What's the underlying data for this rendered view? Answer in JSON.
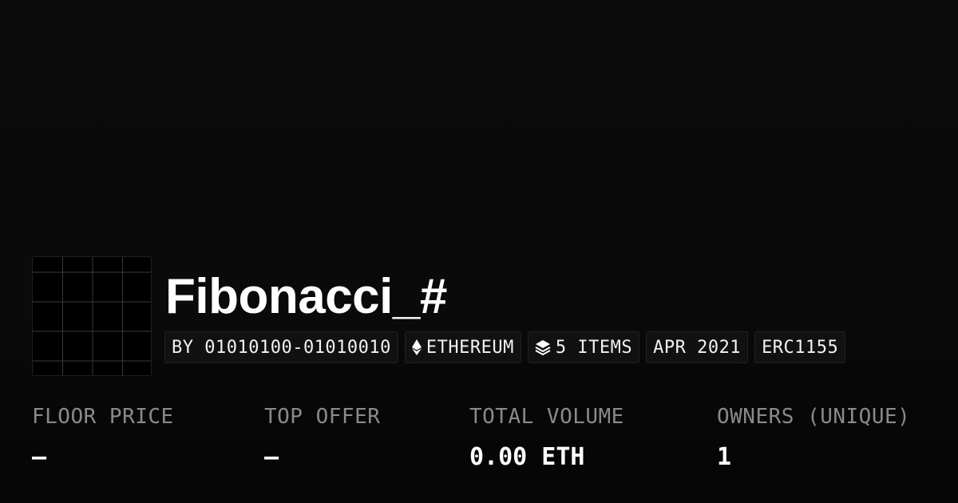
{
  "collection": {
    "name": "Fibonacci_#"
  },
  "chips": {
    "creator": "BY 01010100-01010010",
    "chain": "ETHEREUM",
    "chain_icon": "ethereum-icon",
    "items": "5 ITEMS",
    "items_icon": "layers-icon",
    "date": "APR 2021",
    "standard": "ERC1155"
  },
  "stats": {
    "floor_price": {
      "label": "FLOOR PRICE",
      "value": "—"
    },
    "top_offer": {
      "label": "TOP OFFER",
      "value": "—"
    },
    "total_volume": {
      "label": "TOTAL VOLUME",
      "value": "0.00 ETH"
    },
    "owners": {
      "label": "OWNERS (UNIQUE)",
      "value": "1"
    }
  },
  "colors": {
    "background": "#0a0a0a",
    "text": "#ffffff",
    "muted": "#8a8a8a",
    "chip_bg": "#111111",
    "chip_border": "#222222"
  }
}
